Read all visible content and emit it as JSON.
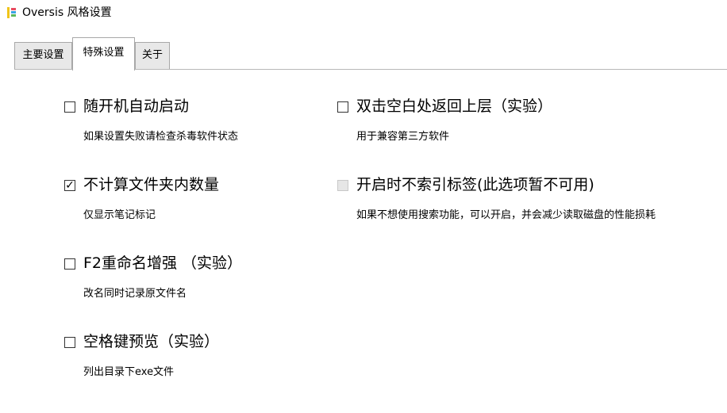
{
  "window": {
    "title": "Oversis 风格设置",
    "icon": "notebook-app-icon"
  },
  "tabs": [
    {
      "label": "主要设置",
      "selected": false
    },
    {
      "label": "特殊设置",
      "selected": true
    },
    {
      "label": "关于",
      "selected": false
    }
  ],
  "options": [
    {
      "label": "随开机自动启动",
      "description": "如果设置失败请检查杀毒软件状态",
      "checked": false,
      "enabled": true,
      "check_mark": ""
    },
    {
      "label": "双击空白处返回上层（实验）",
      "description": "用于兼容第三方软件",
      "checked": false,
      "enabled": true,
      "check_mark": ""
    },
    {
      "label": "不计算文件夹内数量",
      "description": "仅显示笔记标记",
      "checked": true,
      "enabled": true,
      "check_mark": "✓"
    },
    {
      "label": "开启时不索引标签(此选项暂不可用)",
      "description": "如果不想使用搜索功能，可以开启，并会减少读取磁盘的性能损耗",
      "checked": false,
      "enabled": false,
      "check_mark": ""
    },
    {
      "label": "F2重命名增强 （实验）",
      "description": "改名同时记录原文件名",
      "checked": false,
      "enabled": true,
      "check_mark": ""
    },
    {
      "label": "空格键预览（实验）",
      "description": "列出目录下exe文件",
      "checked": false,
      "enabled": true,
      "check_mark": ""
    }
  ]
}
